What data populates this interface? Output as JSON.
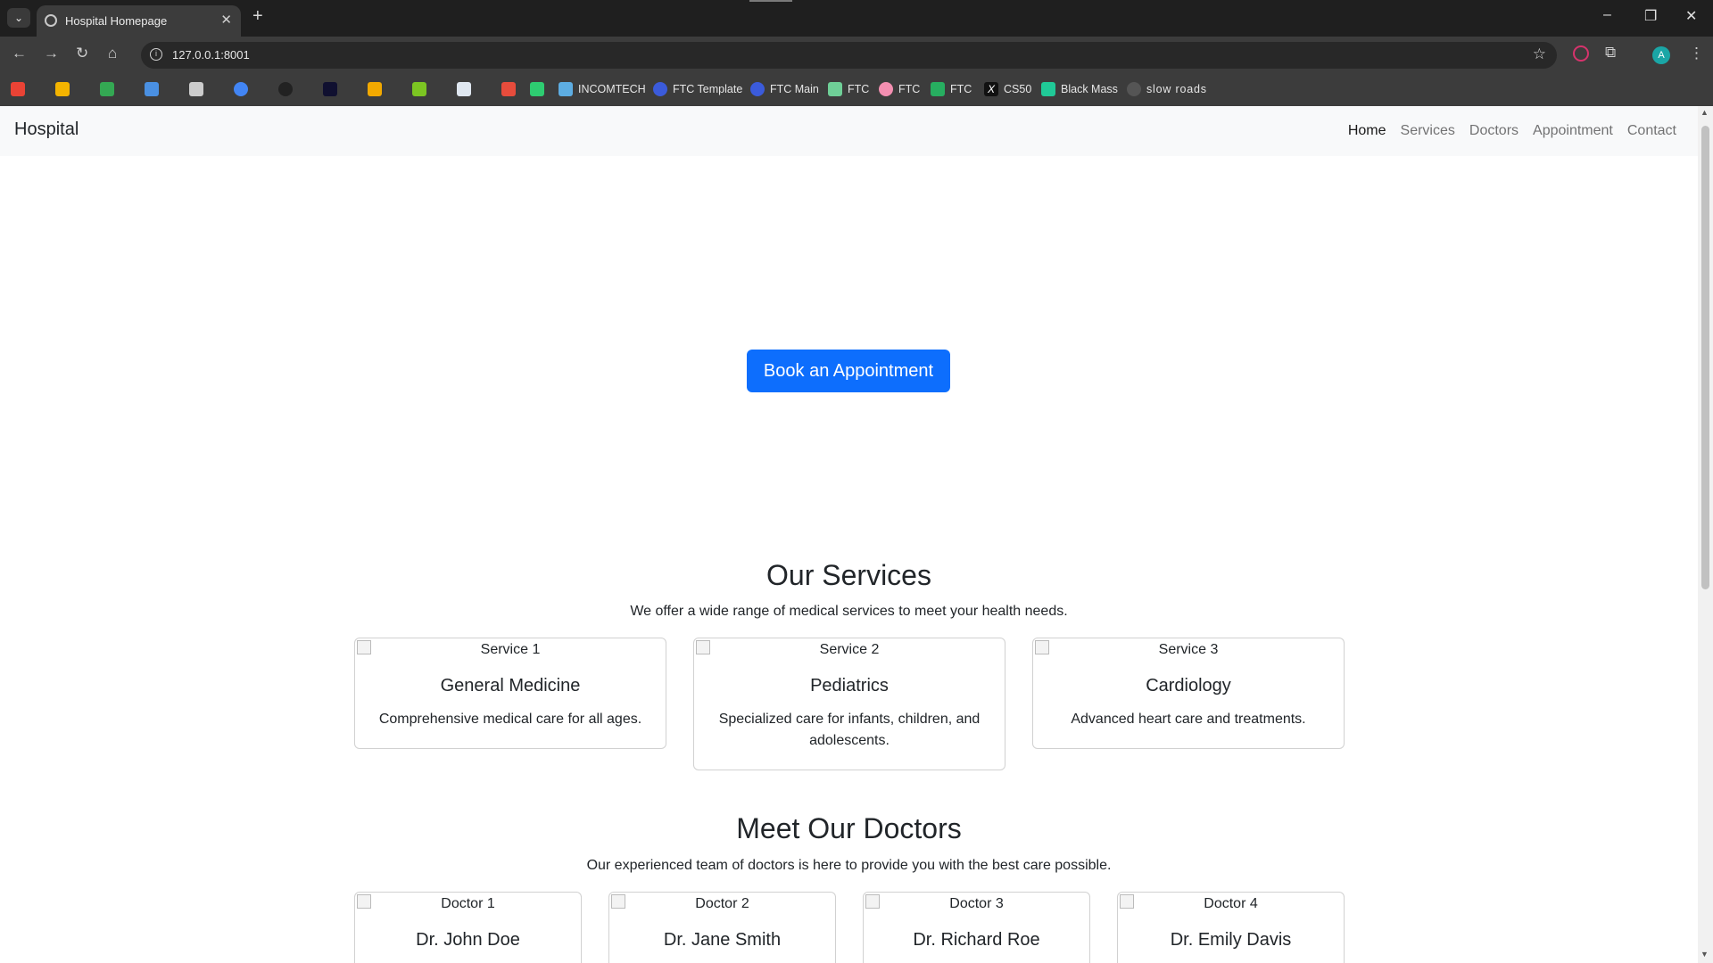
{
  "browser": {
    "tab_title": "Hospital Homepage",
    "url": "127.0.0.1:8001",
    "profile_initial": "A",
    "bookmarks": [
      "INCOMTECH",
      "FTC Template",
      "FTC Main",
      "FTC",
      "FTC",
      "FTC",
      "CS50",
      "Black Mass",
      "slow roads"
    ]
  },
  "navbar": {
    "brand": "Hospital",
    "links": [
      "Home",
      "Services",
      "Doctors",
      "Appointment",
      "Contact"
    ],
    "active": "Home"
  },
  "hero": {
    "button": "Book an Appointment"
  },
  "services": {
    "title": "Our Services",
    "subtitle": "We offer a wide range of medical services to meet your health needs.",
    "items": [
      {
        "img_alt": "Service 1",
        "title": "General Medicine",
        "text": "Comprehensive medical care for all ages."
      },
      {
        "img_alt": "Service 2",
        "title": "Pediatrics",
        "text": "Specialized care for infants, children, and adolescents."
      },
      {
        "img_alt": "Service 3",
        "title": "Cardiology",
        "text": "Advanced heart care and treatments."
      }
    ]
  },
  "doctors": {
    "title": "Meet Our Doctors",
    "subtitle": "Our experienced team of doctors is here to provide you with the best care possible.",
    "items": [
      {
        "img_alt": "Doctor 1",
        "name": "Dr. John Doe"
      },
      {
        "img_alt": "Doctor 2",
        "name": "Dr. Jane Smith"
      },
      {
        "img_alt": "Doctor 3",
        "name": "Dr. Richard Roe"
      },
      {
        "img_alt": "Doctor 4",
        "name": "Dr. Emily Davis"
      }
    ]
  },
  "colors": {
    "primary": "#0d6efd",
    "navbar_bg": "#f8f9fa",
    "browser_dark": "#1f1f1f",
    "browser_toolbar": "#3c3c3c"
  }
}
